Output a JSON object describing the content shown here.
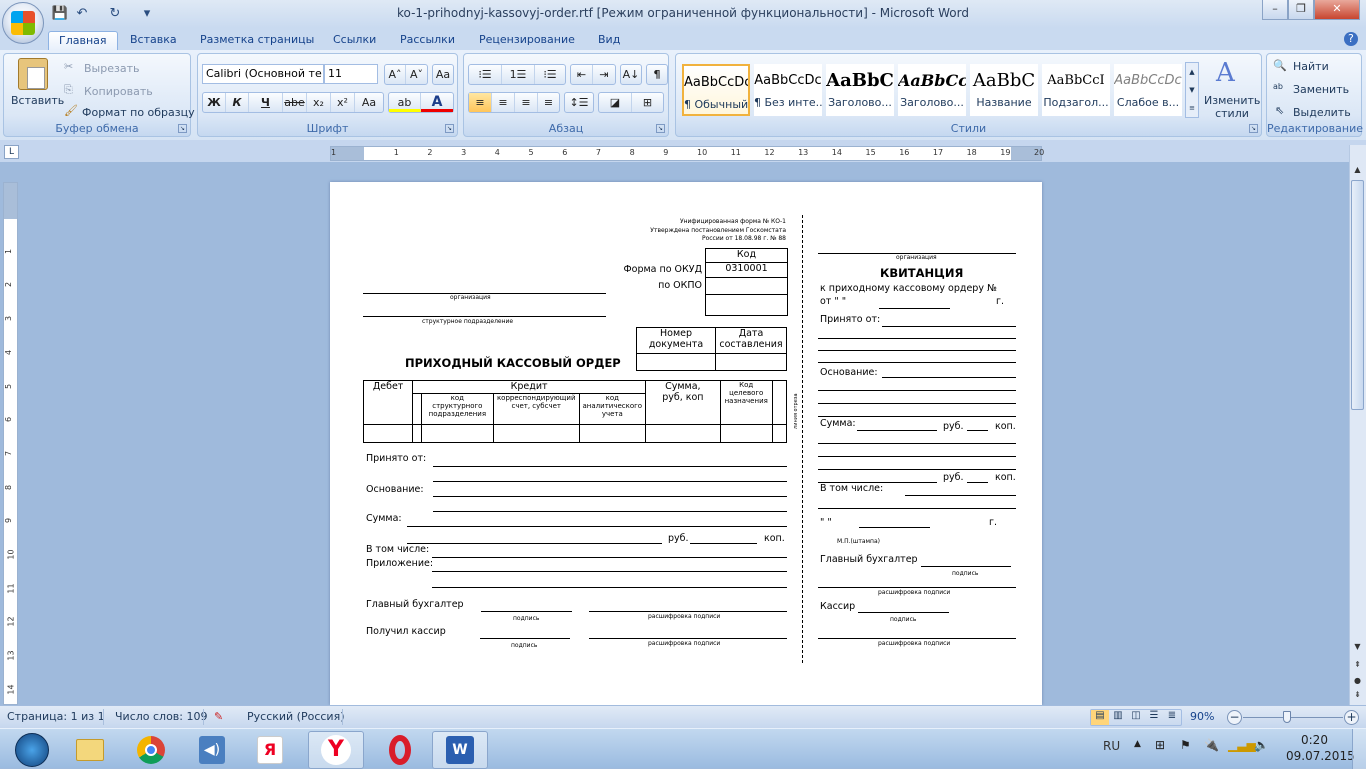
{
  "window": {
    "title": "ko-1-prihodnyj-kassovyj-order.rtf [Режим ограниченной функциональности] - Microsoft Word",
    "minimize": "–",
    "maximize": "❐",
    "close": "✕",
    "help": "?"
  },
  "quick_access": {
    "save": "💾",
    "undo": "↶",
    "redo": "↻",
    "customize": "▾"
  },
  "tabs": [
    "Главная",
    "Вставка",
    "Разметка страницы",
    "Ссылки",
    "Рассылки",
    "Рецензирование",
    "Вид"
  ],
  "ribbon": {
    "clipboard": {
      "label": "Буфер обмена",
      "paste": "Вставить",
      "cut": "Вырезать",
      "copy": "Копировать",
      "format_painter": "Формат по образцу"
    },
    "font": {
      "label": "Шрифт",
      "font_name": "Calibri (Основной те",
      "font_size": "11",
      "grow": "A˄",
      "shrink": "A˅",
      "clear": "Aa",
      "bold": "Ж",
      "italic": "К",
      "underline": "Ч",
      "strike": "abe",
      "sub": "x₂",
      "sup": "x²",
      "case": "Aa",
      "highlight": "ab",
      "color": "A"
    },
    "paragraph": {
      "label": "Абзац",
      "bullets": "⁝☰",
      "numbering": "1☰",
      "multilevel": "⁝☰",
      "dec_indent": "⇤",
      "inc_indent": "⇥",
      "sort": "A↓",
      "pilcrow": "¶",
      "align_left": "≡",
      "center": "≡",
      "right": "≡",
      "justify": "≡",
      "spacing": "↕☰",
      "shading": "◪",
      "borders": "⊞"
    },
    "styles": {
      "label": "Стили",
      "items": [
        {
          "sample": "AaBbCcDc",
          "name": "¶ Обычный"
        },
        {
          "sample": "AaBbCcDc",
          "name": "¶ Без инте..."
        },
        {
          "sample": "AaBbC",
          "name": "Заголово..."
        },
        {
          "sample": "AaBbCc",
          "name": "Заголово..."
        },
        {
          "sample": "AaBbC",
          "name": "Название"
        },
        {
          "sample": "AaBbCcI",
          "name": "Подзагол..."
        },
        {
          "sample": "AaBbCcDc",
          "name": "Слабое в..."
        }
      ],
      "change": "Изменить стили"
    },
    "editing": {
      "label": "Редактирование",
      "find": "Найти",
      "replace": "Заменить",
      "select": "Выделить"
    }
  },
  "ruler_h": [
    "1",
    "1",
    "2",
    "3",
    "4",
    "5",
    "6",
    "7",
    "8",
    "9",
    "10",
    "11",
    "12",
    "13",
    "14",
    "15",
    "16",
    "17",
    "18",
    "19",
    "20"
  ],
  "ruler_v": [
    "1",
    "2",
    "3",
    "4",
    "5",
    "6",
    "7",
    "8",
    "9",
    "10",
    "11",
    "12",
    "13",
    "14"
  ],
  "doc": {
    "header": [
      "Унифицированная  форма  № КО-1",
      "Утверждена  постановлением  Госкомстата",
      "России от 18.08.98  г. № 88"
    ],
    "code_head": "Код",
    "okud_label": "Форма по ОКУД",
    "okud_value": "0310001",
    "okpo_label": "по ОКПО",
    "org_caption": "организация",
    "subdiv_caption": "структурное  подразделение",
    "doc_num": "Номер документа",
    "doc_date": "Дата составления",
    "title": "ПРИХОДНЫЙ КАССОВЫЙ ОРДЕР",
    "table": {
      "debit": "Дебет",
      "credit": "Кредит",
      "sub1": "код структурного подразделения",
      "sub2": "корреспондирующий счет, субсчет",
      "sub3": "код аналитического учета",
      "sum": "Сумма, руб, коп",
      "purpose": "Код целевого назначения"
    },
    "received_from": "Принято от:",
    "basis": "Основание:",
    "sum": "Сумма:",
    "rub": "руб.",
    "kop": "коп.",
    "including": "В том числе:",
    "attachment": "Приложение:",
    "chief_accountant": "Главный бухгалтер",
    "signature": "подпись",
    "decoding": "расшифровка  подписи",
    "cashier_received": "Получил кассир",
    "cut_line": "линия отреза",
    "receipt": {
      "org": "организация",
      "title": "КВИТАНЦИЯ",
      "to_order": "к приходному кассовому ордеру №",
      "from": "от  \"       \"",
      "year": "г.",
      "received_from": "Принято от:",
      "basis": "Основание:",
      "sum": "Сумма:",
      "rub": "руб.",
      "kop": "коп.",
      "including": "В том числе:",
      "date_quote": "\"       \"",
      "stamp": "М.П.(штампа)",
      "chief_accountant": "Главный бухгалтер",
      "signature": "подпись",
      "decoding": "расшифровка  подписи",
      "cashier": "Кассир"
    }
  },
  "status": {
    "page": "Страница: 1 из 1",
    "words": "Число слов: 109",
    "language": "Русский (Россия)",
    "zoom": "90%",
    "zoom_value": 90
  },
  "tray": {
    "lang": "RU",
    "time": "0:20",
    "date": "09.07.2015"
  }
}
